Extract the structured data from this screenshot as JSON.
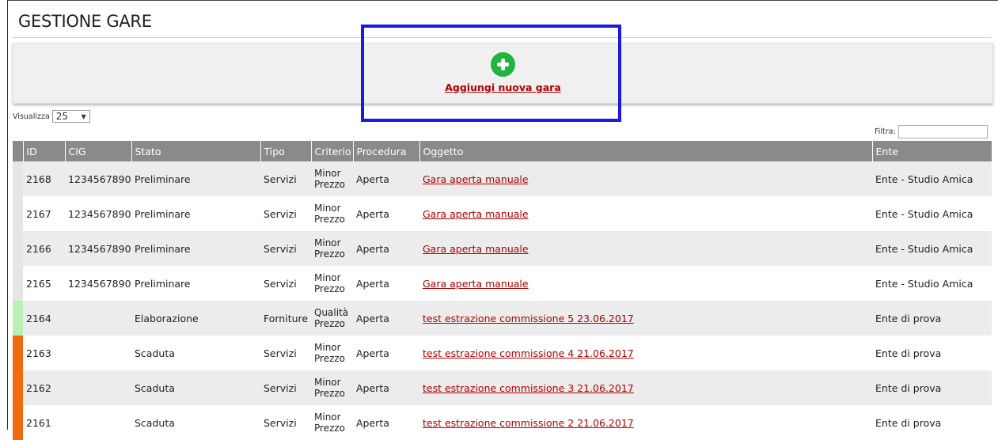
{
  "page": {
    "title": "GESTIONE GARE"
  },
  "actions": {
    "add_label": "Aggiungi nuova gara",
    "add_icon": "plus-circle-icon",
    "add_color": "#22b43e"
  },
  "controls": {
    "show_label": "Visualizza",
    "show_value": "25",
    "filter_label": "Filtra:",
    "filter_value": ""
  },
  "table": {
    "headers": [
      "ID",
      "CIG",
      "Stato",
      "Tipo",
      "Criterio",
      "Procedura",
      "Oggetto",
      "Ente"
    ],
    "rows": [
      {
        "status_color": "#e6e6e6",
        "id": "2168",
        "cig": "1234567890",
        "stato": "Preliminare",
        "tipo": "Servizi",
        "criterio_1": "Minor",
        "criterio_2": "Prezzo",
        "procedura": "Aperta",
        "oggetto": "Gara aperta  manuale",
        "ente": "Ente - Studio Amica"
      },
      {
        "status_color": "#e6e6e6",
        "id": "2167",
        "cig": "1234567890",
        "stato": "Preliminare",
        "tipo": "Servizi",
        "criterio_1": "Minor",
        "criterio_2": "Prezzo",
        "procedura": "Aperta",
        "oggetto": "Gara aperta  manuale",
        "ente": "Ente - Studio Amica"
      },
      {
        "status_color": "#e6e6e6",
        "id": "2166",
        "cig": "1234567890",
        "stato": "Preliminare",
        "tipo": "Servizi",
        "criterio_1": "Minor",
        "criterio_2": "Prezzo",
        "procedura": "Aperta",
        "oggetto": "Gara aperta  manuale",
        "ente": "Ente - Studio Amica"
      },
      {
        "status_color": "#e6e6e6",
        "id": "2165",
        "cig": "1234567890",
        "stato": "Preliminare",
        "tipo": "Servizi",
        "criterio_1": "Minor",
        "criterio_2": "Prezzo",
        "procedura": "Aperta",
        "oggetto": "Gara aperta  manuale",
        "ente": "Ente - Studio Amica"
      },
      {
        "status_color": "#b8f0b8",
        "id": "2164",
        "cig": "",
        "stato": "Elaborazione",
        "tipo": "Forniture",
        "criterio_1": "Qualità",
        "criterio_2": "Prezzo",
        "procedura": "Aperta",
        "oggetto": "test  estrazione commissione  5  23.06.2017",
        "ente": "Ente di prova"
      },
      {
        "status_color": "#f06a10",
        "id": "2163",
        "cig": "",
        "stato": "Scaduta",
        "tipo": "Servizi",
        "criterio_1": "Minor",
        "criterio_2": "Prezzo",
        "procedura": "Aperta",
        "oggetto": "test  estrazione commissione 4  21.06.2017",
        "ente": "Ente di prova"
      },
      {
        "status_color": "#f06a10",
        "id": "2162",
        "cig": "",
        "stato": "Scaduta",
        "tipo": "Servizi",
        "criterio_1": "Minor",
        "criterio_2": "Prezzo",
        "procedura": "Aperta",
        "oggetto": "test  estrazione commissione 3  21.06.2017",
        "ente": "Ente di prova"
      },
      {
        "status_color": "#f06a10",
        "id": "2161",
        "cig": "",
        "stato": "Scaduta",
        "tipo": "Servizi",
        "criterio_1": "Minor",
        "criterio_2": "Prezzo",
        "procedura": "Aperta",
        "oggetto": "test  estrazione commissione 2  21.06.2017",
        "ente": "Ente di prova"
      }
    ]
  }
}
